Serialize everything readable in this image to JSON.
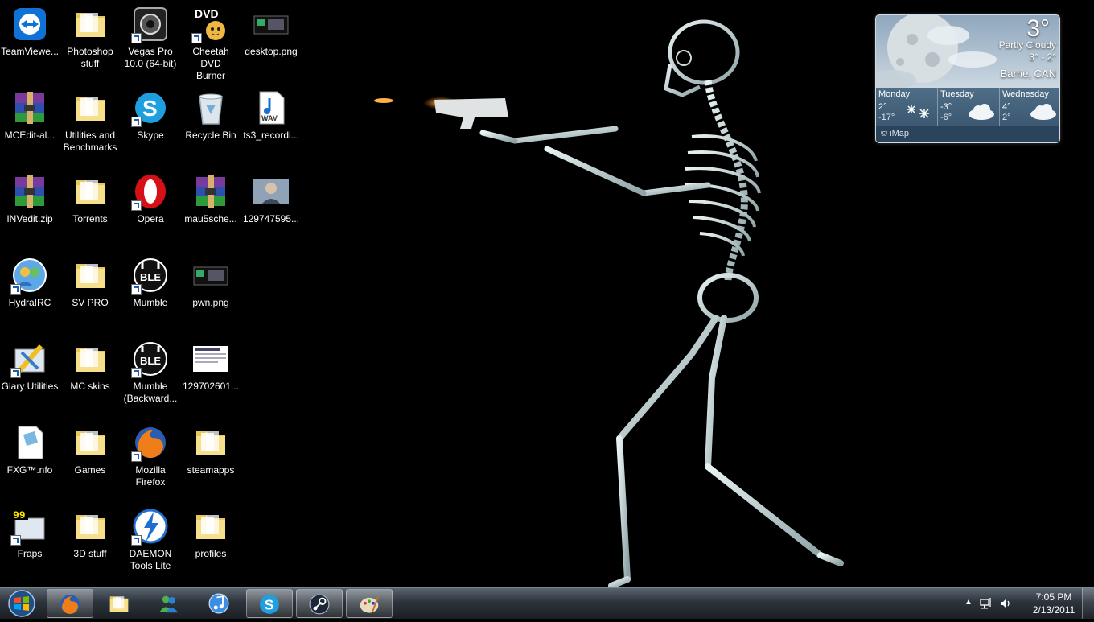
{
  "desktop": {
    "icons": [
      {
        "label": "TeamViewe...",
        "icon": "teamviewer-icon",
        "shortcut": false
      },
      {
        "label": "Photoshop\nstuff",
        "icon": "folder-icon",
        "shortcut": false
      },
      {
        "label": "Vegas Pro\n10.0 (64-bit)",
        "icon": "vegas-pro-icon",
        "shortcut": true
      },
      {
        "label": "Cheetah DVD\nBurner",
        "icon": "dvd-burner-icon",
        "shortcut": true
      },
      {
        "label": "desktop.png",
        "icon": "image-file-icon",
        "shortcut": false
      },
      {
        "label": "MCEdit-al...",
        "icon": "winrar-archive-icon",
        "shortcut": false
      },
      {
        "label": "Utilities and\nBenchmarks",
        "icon": "folder-icon",
        "shortcut": false
      },
      {
        "label": "Skype",
        "icon": "skype-icon",
        "shortcut": true
      },
      {
        "label": "Recycle Bin",
        "icon": "recycle-bin-icon",
        "shortcut": false
      },
      {
        "label": "ts3_recordi...",
        "icon": "wav-file-icon",
        "shortcut": false
      },
      {
        "label": "INVedit.zip",
        "icon": "winrar-archive-icon",
        "shortcut": false
      },
      {
        "label": "Torrents",
        "icon": "folder-icon",
        "shortcut": false
      },
      {
        "label": "Opera",
        "icon": "opera-icon",
        "shortcut": true
      },
      {
        "label": "mau5sche...",
        "icon": "winrar-archive-icon",
        "shortcut": false
      },
      {
        "label": "129747595...",
        "icon": "photo-file-icon",
        "shortcut": false
      },
      {
        "label": "HydraIRC",
        "icon": "hydrairc-icon",
        "shortcut": true
      },
      {
        "label": "SV PRO",
        "icon": "folder-icon",
        "shortcut": false
      },
      {
        "label": "Mumble",
        "icon": "mumble-icon",
        "shortcut": true
      },
      {
        "label": "pwn.png",
        "icon": "image-file-icon",
        "shortcut": false
      },
      {
        "label": "Glary Utilities",
        "icon": "glary-utilities-icon",
        "shortcut": true
      },
      {
        "label": "MC skins",
        "icon": "folder-icon",
        "shortcut": false
      },
      {
        "label": "Mumble\n(Backward...",
        "icon": "mumble-icon",
        "shortcut": true
      },
      {
        "label": "129702601...",
        "icon": "screenshot-file-icon",
        "shortcut": false
      },
      {
        "label": "FXG™.nfo",
        "icon": "nfo-file-icon",
        "shortcut": false
      },
      {
        "label": "Games",
        "icon": "folder-icon",
        "shortcut": false
      },
      {
        "label": "Mozilla\nFirefox",
        "icon": "firefox-icon",
        "shortcut": true
      },
      {
        "label": "steamapps",
        "icon": "folder-icon",
        "shortcut": false
      },
      {
        "label": "Fraps",
        "icon": "fraps-icon",
        "shortcut": true
      },
      {
        "label": "3D stuff",
        "icon": "folder-icon",
        "shortcut": false
      },
      {
        "label": "DAEMON\nTools Lite",
        "icon": "daemon-tools-icon",
        "shortcut": true
      },
      {
        "label": "profiles",
        "icon": "folder-icon",
        "shortcut": false
      }
    ]
  },
  "weather": {
    "current_temp": "3°",
    "condition": "Partly Cloudy",
    "range": "3° - 2°",
    "city": "Barrie, CAN",
    "forecast": [
      {
        "day": "Monday",
        "high": "2°",
        "low": "-17°",
        "icon": "snow-icon"
      },
      {
        "day": "Tuesday",
        "high": "-3°",
        "low": "-6°",
        "icon": "cloud-icon"
      },
      {
        "day": "Wednesday",
        "high": "4°",
        "low": "2°",
        "icon": "cloud-icon"
      }
    ],
    "credit": "© iMap"
  },
  "taskbar": {
    "buttons": [
      {
        "name": "firefox",
        "icon": "firefox-icon",
        "active": true
      },
      {
        "name": "windows-explorer",
        "icon": "folder-icon",
        "active": false
      },
      {
        "name": "messenger",
        "icon": "messenger-icon",
        "active": false
      },
      {
        "name": "itunes",
        "icon": "itunes-icon",
        "active": false
      },
      {
        "name": "skype",
        "icon": "skype-icon",
        "active": true
      },
      {
        "name": "steam",
        "icon": "steam-icon",
        "active": true
      },
      {
        "name": "paint",
        "icon": "paint-icon",
        "active": true
      }
    ],
    "clock": {
      "time": "7:05 PM",
      "date": "2/13/2011"
    }
  },
  "colors": {
    "accent": "#1a5fb4",
    "folder": "#f2d774",
    "taskbar": "#2c333b"
  }
}
